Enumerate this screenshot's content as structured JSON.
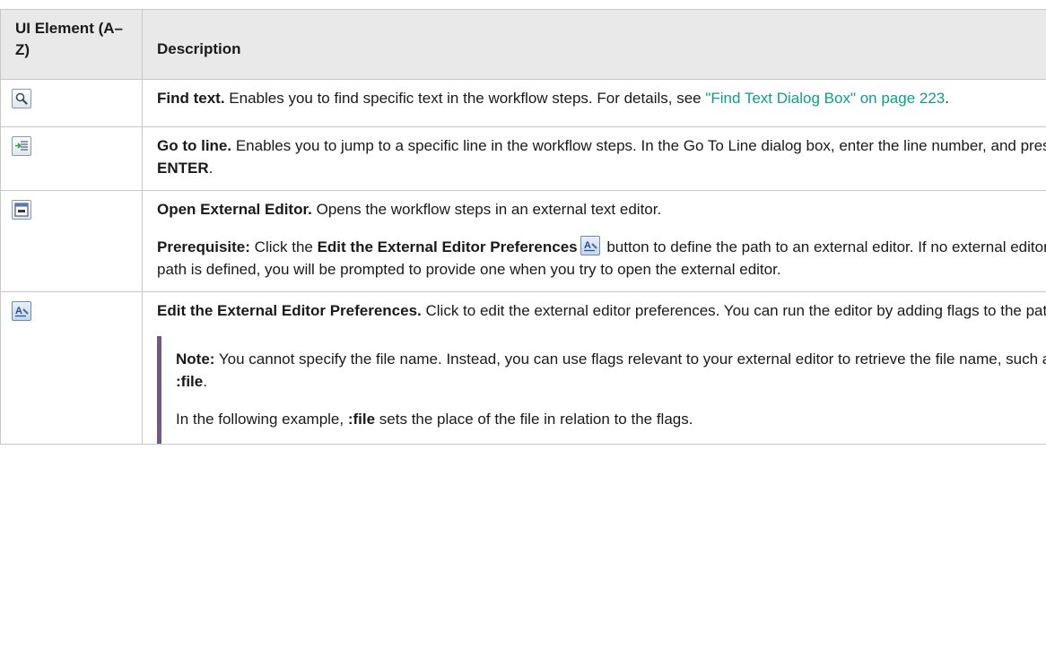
{
  "header": {
    "col1": "UI Element (A–Z)",
    "col2": "Description"
  },
  "rows": [
    {
      "icon": "search-icon",
      "title": "Find text.",
      "text": " Enables you to find specific text in the workflow steps. For details, see ",
      "link": "\"Find Text Dialog Box\" on page 223",
      "tail": "."
    },
    {
      "icon": "go-to-line-icon",
      "title": "Go to line.",
      "text": " Enables you to jump to a specific line in the workflow steps. In the Go To Line dialog box, enter the line number, and press ",
      "bold": "ENTER",
      "tail": "."
    },
    {
      "icon": "external-editor-icon",
      "title": "Open External Editor.",
      "text": " Opens the workflow steps in an external text editor.",
      "prereq_label": "Prerequisite:",
      "prereq_text1": " Click the ",
      "prereq_bold": "Edit the External Editor Preferences",
      "prereq_text2": " button to define the path to an external editor. If no external editor path is defined, you will be prompted to provide one when you try to open the external editor."
    },
    {
      "icon": "editor-preferences-icon",
      "title": "Edit the External Editor Preferences.",
      "text": " Click to edit the external editor preferences. You can run the editor by adding flags to the path.",
      "note_label": "Note:",
      "note_text": "  You cannot specify the file name. Instead, you can use flags relevant to your external editor to retrieve the file name, such as ",
      "note_bold": ":file",
      "note_tail": ".",
      "ex_text1": "In the following example, ",
      "ex_bold": ":file",
      "ex_text2": " sets the place of the file in relation to the flags."
    }
  ]
}
